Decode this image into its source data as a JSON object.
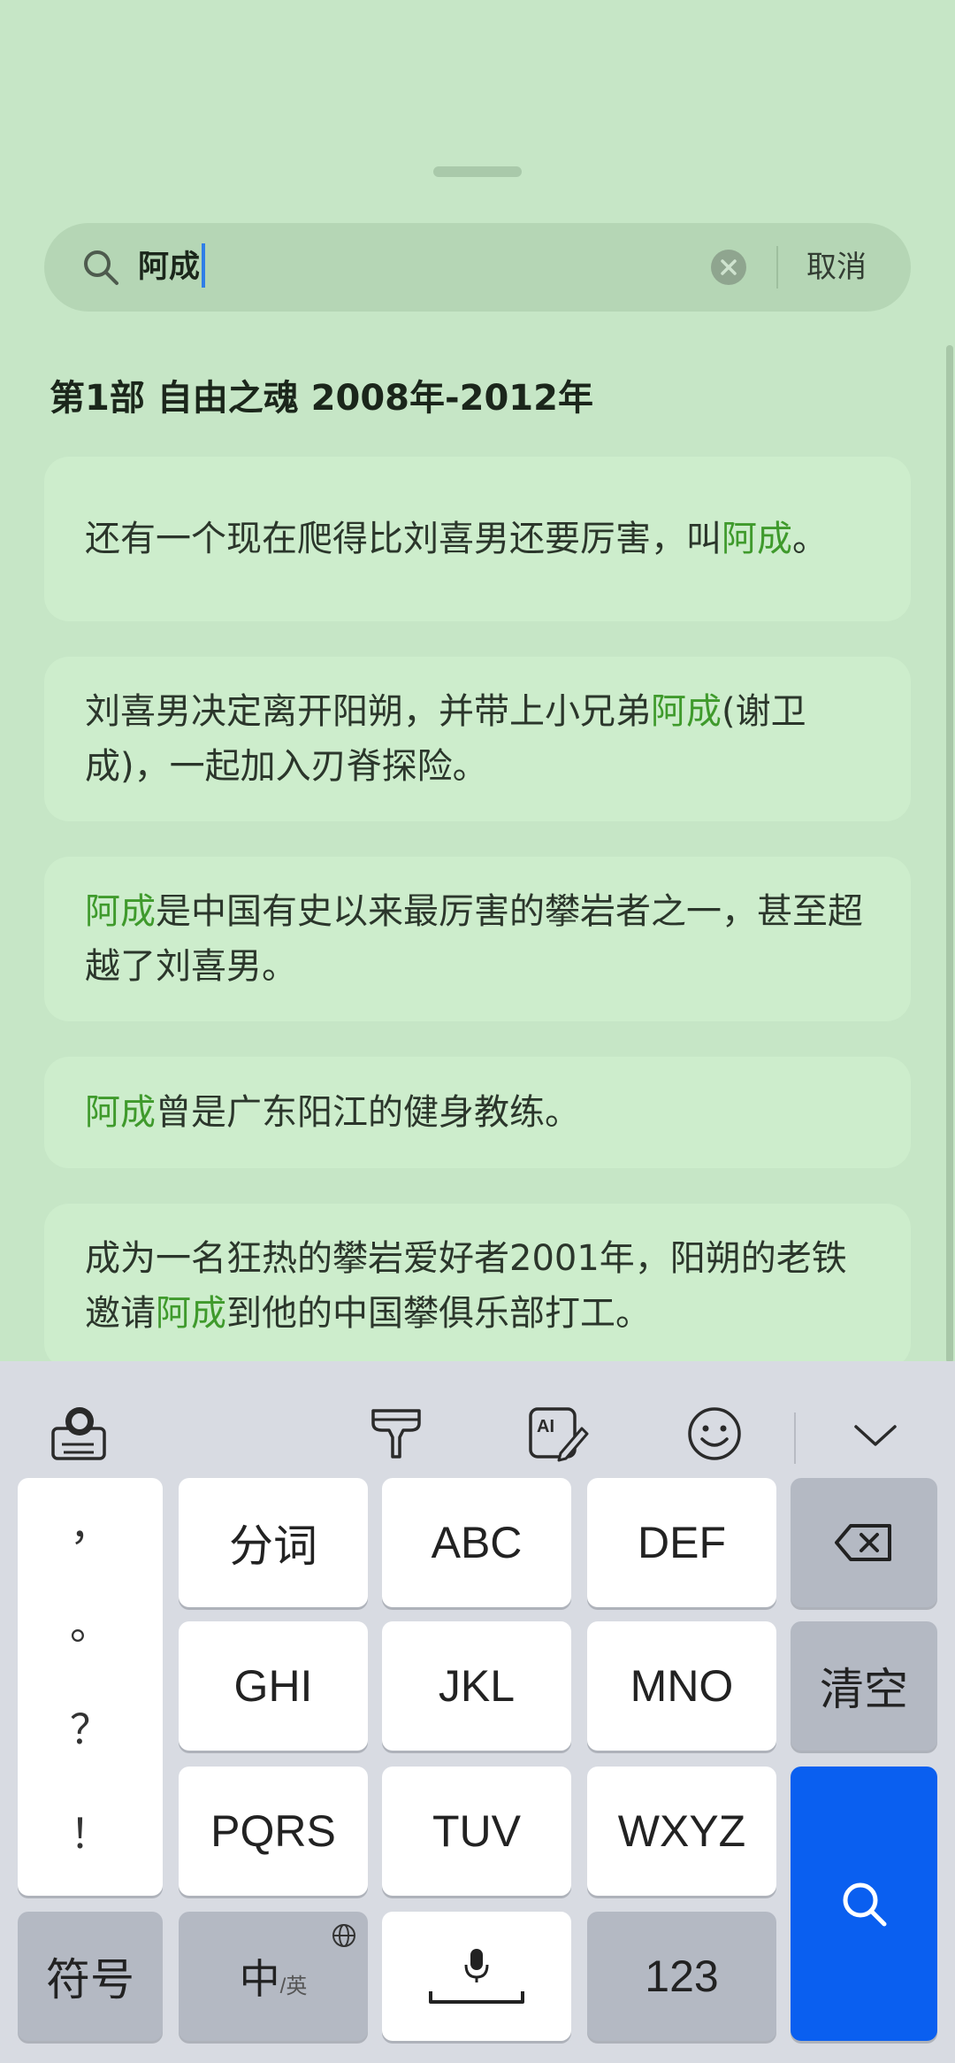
{
  "search": {
    "query": "阿成",
    "cancel_label": "取消"
  },
  "section_title": "第1部 自由之魂 2008年-2012年",
  "highlight_color": "#3f9a2c",
  "results": [
    {
      "pre": "还有一个现在爬得比刘喜男还要厉害，叫",
      "match": "阿成",
      "post": "。"
    },
    {
      "pre": "刘喜男决定离开阳朔，并带上小兄弟",
      "match": "阿成",
      "post": "(谢卫成)，一起加入刃脊探险。"
    },
    {
      "pre": "",
      "match": "阿成",
      "post": "是中国有史以来最厉害的攀岩者之一，甚至超越了刘喜男。"
    },
    {
      "pre": "",
      "match": "阿成",
      "post": "曾是广东阳江的健身教练。"
    },
    {
      "pre": "成为一名狂热的攀岩爱好者2001年，阳朔的老铁邀请",
      "match": "阿成",
      "post": "到他的中国攀俱乐部打工。"
    }
  ],
  "keyboard": {
    "toolbar_icons": [
      "keyboard-settings-icon",
      "brush-icon",
      "ai-write-icon",
      "emoji-icon",
      "collapse-chevron-icon"
    ],
    "punctuation": [
      "，",
      "。",
      "？",
      "！"
    ],
    "row1": [
      "分词",
      "ABC",
      "DEF"
    ],
    "row2": [
      "GHI",
      "JKL",
      "MNO"
    ],
    "row3": [
      "PQRS",
      "TUV",
      "WXYZ"
    ],
    "clear_label": "清空",
    "symbols_label": "符号",
    "lang_main": "中",
    "lang_sub": "/英",
    "numbers_label": "123",
    "accent_color": "#0a5ff0"
  }
}
